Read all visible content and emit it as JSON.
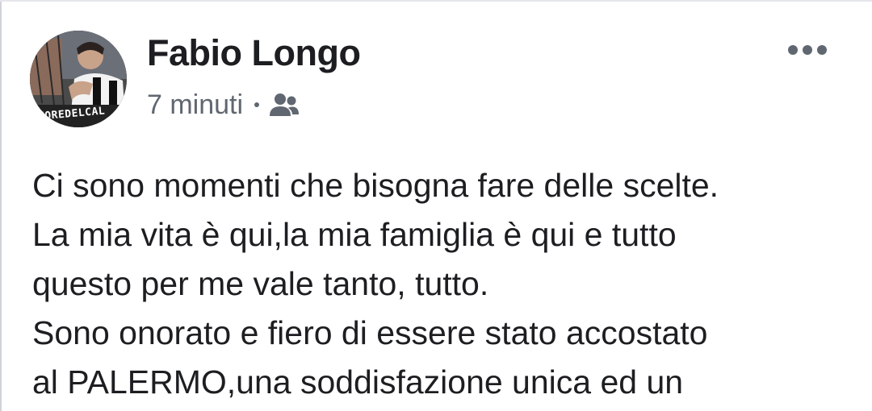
{
  "post": {
    "author": "Fabio Longo",
    "timestamp": "7 minuti",
    "separator_icon": "dot",
    "audience_icon": "friends-icon",
    "more_icon": "more-options-icon",
    "avatar_caption": "UOREDELCAL",
    "text_lines": [
      "Ci sono momenti che bisogna fare delle scelte.",
      "La mia vita è qui,la mia famiglia è qui e tutto",
      "questo per me vale tanto, tutto.",
      "Sono onorato e fiero di essere stato accostato",
      "al PALERMO,una soddisfazione unica ed un"
    ]
  },
  "colors": {
    "text_primary": "#1c1e21",
    "text_secondary": "#606770",
    "icon": "#606770",
    "background": "#ffffff"
  }
}
